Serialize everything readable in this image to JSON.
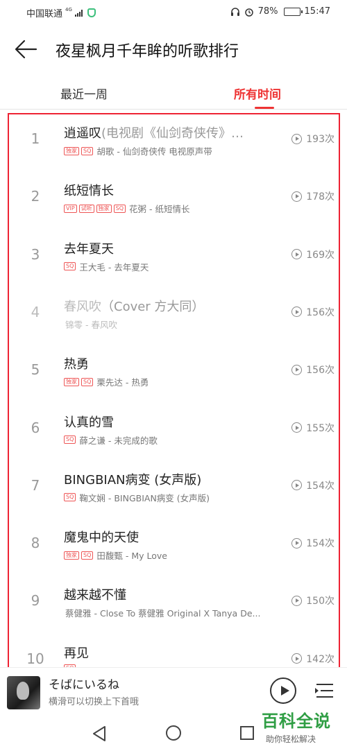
{
  "status_bar": {
    "carrier": "中国联通",
    "network": "4G",
    "battery": "78%",
    "time": "15:47"
  },
  "header": {
    "title": "夜星枫月千年眸的听歌排行"
  },
  "tabs": [
    {
      "label": "最近一周",
      "active": false
    },
    {
      "label": "所有时间",
      "active": true
    }
  ],
  "songs": [
    {
      "rank": "1",
      "name": "逍遥叹",
      "alias": "(电视剧《仙剑奇侠传》…",
      "badges": [
        "独家",
        "SQ"
      ],
      "meta": "胡歌 - 仙剑奇侠传 电视原声带",
      "count": "193次",
      "unavailable": false
    },
    {
      "rank": "2",
      "name": "纸短情长",
      "alias": "",
      "badges": [
        "VIP",
        "试听",
        "独家",
        "SQ"
      ],
      "meta": "花粥 - 纸短情长",
      "count": "178次",
      "unavailable": false
    },
    {
      "rank": "3",
      "name": "去年夏天",
      "alias": "",
      "badges": [
        "SQ"
      ],
      "meta": "王大毛 - 去年夏天",
      "count": "169次",
      "unavailable": false
    },
    {
      "rank": "4",
      "name": "春风吹",
      "alias": "（Cover 方大同）",
      "badges": [],
      "meta": "锦零 - 春风吹",
      "count": "156次",
      "unavailable": true
    },
    {
      "rank": "5",
      "name": "热勇",
      "alias": "",
      "badges": [
        "独家",
        "SQ"
      ],
      "meta": "栗先达 - 热勇",
      "count": "156次",
      "unavailable": false
    },
    {
      "rank": "6",
      "name": "认真的雪",
      "alias": "",
      "badges": [
        "SQ"
      ],
      "meta": "薛之谦 - 未完成的歌",
      "count": "155次",
      "unavailable": false
    },
    {
      "rank": "7",
      "name": "BINGBIAN病变 (女声版)",
      "alias": "",
      "badges": [
        "SQ"
      ],
      "meta": "鞠文娴 - BINGBIAN病变 (女声版)",
      "count": "154次",
      "unavailable": false
    },
    {
      "rank": "8",
      "name": "魔鬼中的天使",
      "alias": "",
      "badges": [
        "独家",
        "SQ"
      ],
      "meta": "田馥甄 - My Love",
      "count": "154次",
      "unavailable": false
    },
    {
      "rank": "9",
      "name": "越来越不懂",
      "alias": "",
      "badges": [],
      "meta": "蔡健雅 - Close To 蔡健雅 Original X Tanya De...",
      "count": "150次",
      "unavailable": false
    },
    {
      "rank": "10",
      "name": "再见",
      "alias": "",
      "badges": [
        "SQ"
      ],
      "meta": "",
      "count": "142次",
      "unavailable": false
    }
  ],
  "player": {
    "title": "そばにいるね",
    "subtitle": "横滑可以切换上下首哦"
  },
  "watermark": {
    "line1": "百科全说",
    "line2": "助你轻松解决"
  },
  "colors": {
    "accent": "#e33333",
    "highlight_box": "#e22233",
    "watermark": "#2f9e44"
  }
}
